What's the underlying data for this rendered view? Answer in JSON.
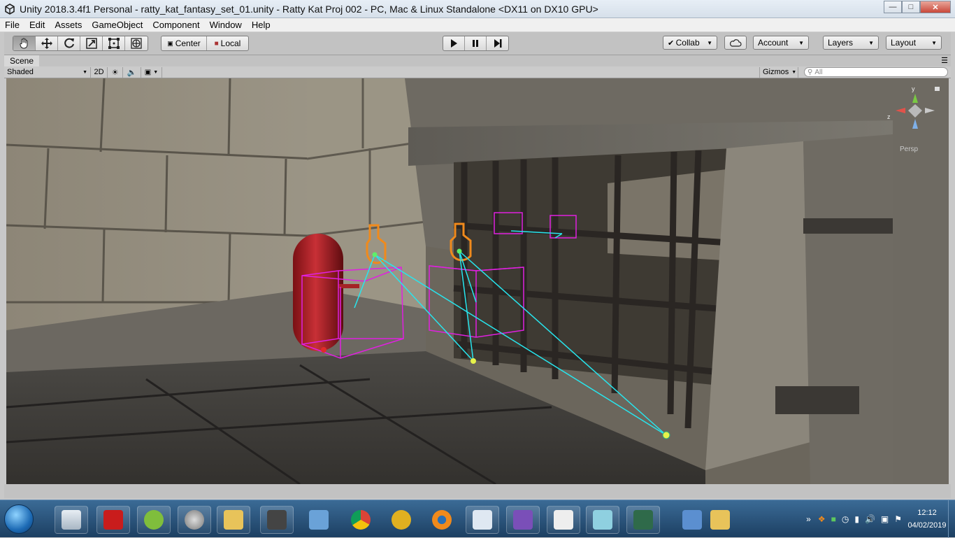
{
  "window": {
    "title": "Unity 2018.3.4f1 Personal - ratty_kat_fantasy_set_01.unity - Ratty Kat Proj 002 - PC, Mac & Linux Standalone <DX11 on DX10 GPU>"
  },
  "menu": [
    "File",
    "Edit",
    "Assets",
    "GameObject",
    "Component",
    "Window",
    "Help"
  ],
  "toolbar": {
    "tools": [
      "hand-icon",
      "move-icon",
      "rotate-icon",
      "scale-icon",
      "rect-icon",
      "transform-icon"
    ],
    "pivot_center": "Center",
    "pivot_local": "Local",
    "collab": "Collab",
    "account": "Account",
    "layers": "Layers",
    "layout": "Layout"
  },
  "scene": {
    "tab": "Scene",
    "shading": "Shaded",
    "mode_2d": "2D",
    "gizmos": "Gizmos",
    "search_placeholder": "All",
    "gizmo_axis_y": "y",
    "gizmo_axis_z": "z",
    "gizmo_persp": "Persp"
  },
  "taskbar": {
    "time": "12:12",
    "date": "04/02/2019",
    "apps": [
      "calculator",
      "filezilla",
      "android-studio",
      "speakers",
      "folder",
      "movie-maker",
      "remote-desktop",
      "chrome",
      "headphones",
      "blender",
      "paint",
      "visual-studio",
      "unity",
      "notepad",
      "monitor",
      "computer",
      "folder-2"
    ]
  },
  "colors": {
    "accent": "#3b6b96",
    "gizmo_cyan": "#27e6ee",
    "gizmo_magenta": "#e020e0",
    "gizmo_orange": "#f08a1c",
    "capsule_red": "#b5242a"
  }
}
